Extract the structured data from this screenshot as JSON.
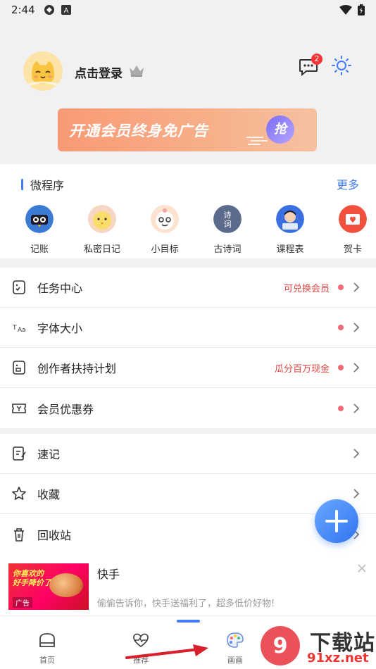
{
  "status_bar": {
    "time": "2:44"
  },
  "profile": {
    "login_label": "点击登录",
    "message_badge": "2"
  },
  "banner": {
    "text": "开通会员终身免广告",
    "grab_label": "抢"
  },
  "mini_programs": {
    "title": "微程序",
    "more_label": "更多",
    "items": [
      {
        "label": "记账",
        "icon": "accounting-owl-icon"
      },
      {
        "label": "私密日记",
        "icon": "diary-chick-icon"
      },
      {
        "label": "小目标",
        "icon": "goal-face-icon"
      },
      {
        "label": "古诗词",
        "icon": "poetry-icon"
      },
      {
        "label": "课程表",
        "icon": "class-schedule-icon"
      },
      {
        "label": "贺卡",
        "icon": "greeting-card-icon"
      }
    ]
  },
  "menu_group_1": [
    {
      "label": "任务中心",
      "tag": "可兑换会员",
      "dot": true,
      "icon": "task-icon"
    },
    {
      "label": "字体大小",
      "tag": "",
      "dot": true,
      "icon": "font-size-icon"
    },
    {
      "label": "创作者扶持计划",
      "tag": "瓜分百万现金",
      "dot": true,
      "icon": "creator-icon"
    },
    {
      "label": "会员优惠券",
      "tag": "",
      "dot": true,
      "icon": "coupon-icon"
    }
  ],
  "menu_group_2": [
    {
      "label": "速记",
      "icon": "quick-note-icon"
    },
    {
      "label": "收藏",
      "icon": "star-icon"
    },
    {
      "label": "回收站",
      "icon": "trash-icon"
    }
  ],
  "ad": {
    "title": "快手",
    "description": "偷偷告诉你，快手送福利了，超多低价好物!",
    "image_text_1": "你喜欢的",
    "image_text_2": "好手降价了",
    "ad_tag": "广告"
  },
  "tabbar": {
    "tabs": [
      {
        "label": "首页",
        "icon": "home-icon"
      },
      {
        "label": "推荐",
        "icon": "heart-pulse-icon"
      },
      {
        "label": "画画",
        "icon": "palette-icon"
      }
    ]
  },
  "watermark": {
    "brand": "下载站",
    "url": "91xz.net"
  },
  "colors": {
    "accent": "#3f7cf5",
    "tag_red": "#e0443e",
    "dot": "#f06a78",
    "banner_start": "#f89a76"
  }
}
